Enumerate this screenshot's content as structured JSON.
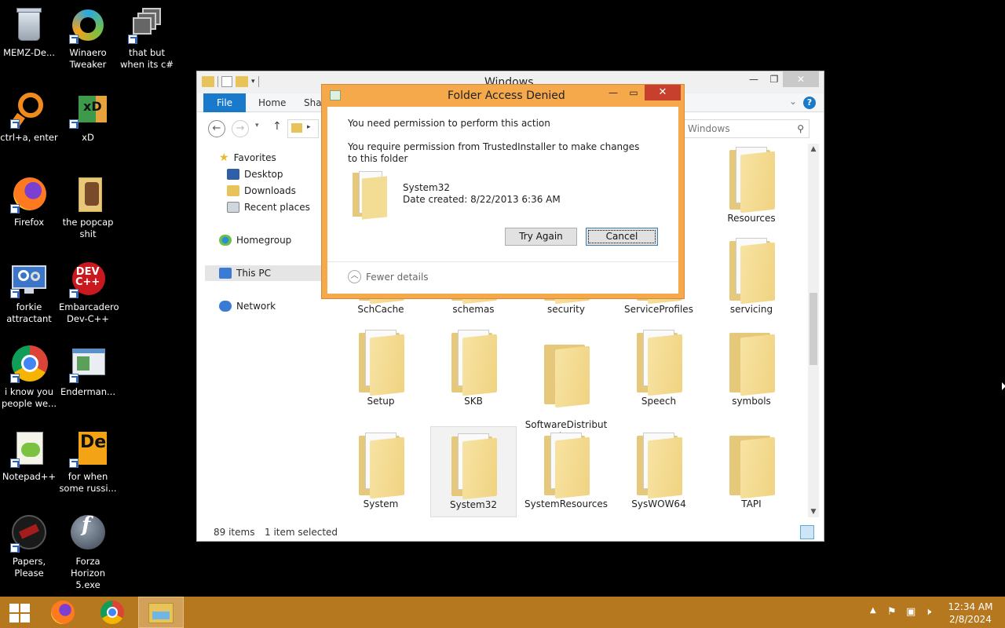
{
  "desktop": {
    "icons": [
      {
        "label": "MEMZ-De...",
        "icon": "recycle-bin-icon"
      },
      {
        "label": "Winaero\nTweaker",
        "icon": "winaero-icon"
      },
      {
        "label": "that but\nwhen its c#",
        "icon": "stack-windows-icon"
      },
      {
        "label": "ctrl+a, enter",
        "icon": "orange-ring-icon"
      },
      {
        "label": "xD",
        "icon": "xd-app-icon"
      },
      {
        "label": "Firefox",
        "icon": "firefox-icon"
      },
      {
        "label": "the popcap\nshit",
        "icon": "popcap-folder-icon"
      },
      {
        "label": "forkie\nattractant",
        "icon": "monitor-gears-icon"
      },
      {
        "label": "Embarcadero\nDev-C++",
        "icon": "devcpp-icon"
      },
      {
        "label": "i know you\npeople we...",
        "icon": "chrome-icon"
      },
      {
        "label": "Enderman...",
        "icon": "window-app-icon"
      },
      {
        "label": "Notepad++",
        "icon": "notepadpp-icon"
      },
      {
        "label": "for when\nsome russi...",
        "icon": "de-app-icon"
      },
      {
        "label": "Papers,\nPlease",
        "icon": "papers-please-icon"
      },
      {
        "label": "Forza\nHorizon 5.exe",
        "icon": "flash-icon"
      }
    ]
  },
  "explorer": {
    "title": "Windows",
    "tabs": {
      "file": "File",
      "home": "Home",
      "share": "Shar"
    },
    "search_placeholder": "Windows",
    "nav": {
      "favorites": "Favorites",
      "desktop": "Desktop",
      "downloads": "Downloads",
      "recent": "Recent places",
      "homegroup": "Homegroup",
      "thispc": "This PC",
      "network": "Network"
    },
    "folders": {
      "resources": "Resources",
      "schcache": "SchCache",
      "schemas": "schemas",
      "security": "security",
      "serviceprofiles": "ServiceProfiles",
      "servicing": "servicing",
      "setup": "Setup",
      "skb": "SKB",
      "softwaredistribution": "SoftwareDistribut\nion",
      "speech": "Speech",
      "symbols": "symbols",
      "system": "System",
      "system32": "System32",
      "systemresources": "SystemResources",
      "syswow64": "SysWOW64",
      "tapi": "TAPI"
    },
    "status": {
      "items": "89 items",
      "selected": "1 item selected"
    }
  },
  "dialog": {
    "title": "Folder Access Denied",
    "message1": "You need permission to perform this action",
    "message2": "You require permission from TrustedInstaller to make changes to this folder",
    "folder_name": "System32",
    "date_created": "Date created: 8/22/2013 6:36 AM",
    "try_again": "Try Again",
    "cancel": "Cancel",
    "fewer_details": "Fewer details"
  },
  "taskbar": {
    "time": "12:34 AM",
    "date": "2/8/2024"
  },
  "colors": {
    "taskbar": "#b5781f",
    "dialog_frame": "#f5a94b",
    "file_tab": "#1979ca",
    "close_button": "#c7402d"
  }
}
